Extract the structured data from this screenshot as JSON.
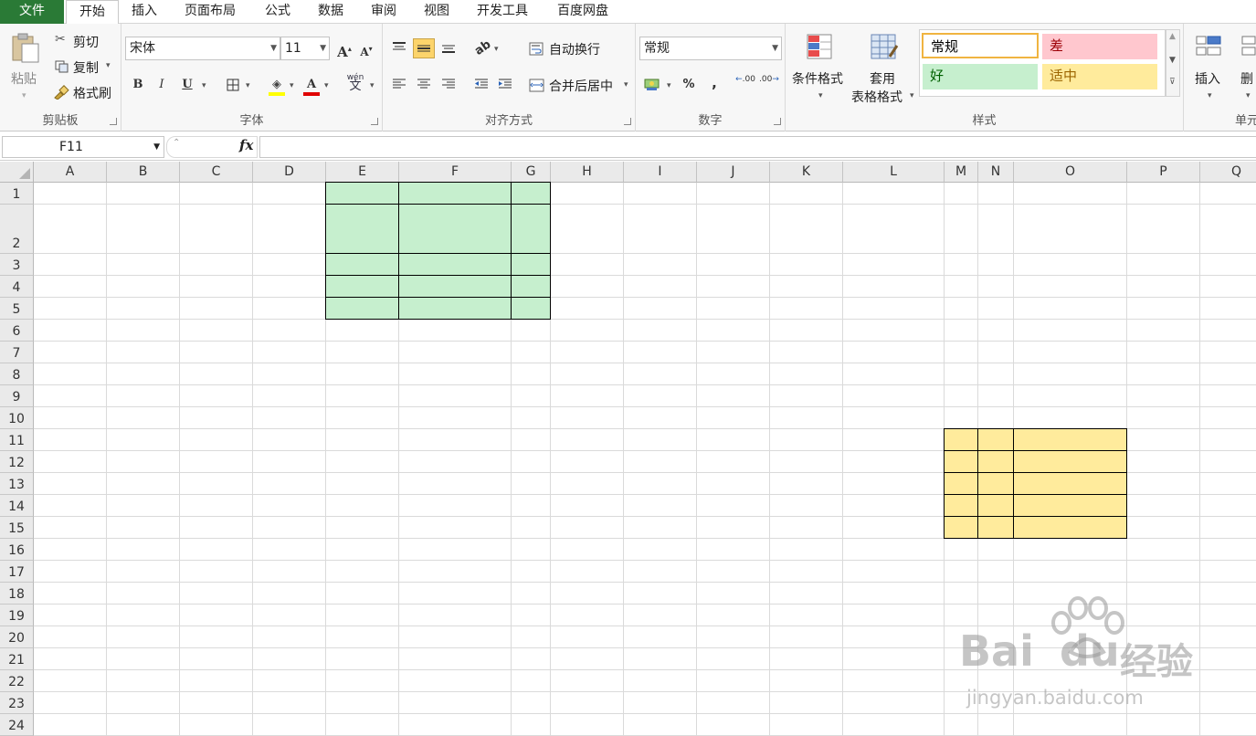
{
  "tabs": {
    "file": "文件",
    "home": "开始",
    "insert": "插入",
    "page_layout": "页面布局",
    "formulas": "公式",
    "data": "数据",
    "review": "审阅",
    "view": "视图",
    "developer": "开发工具",
    "baidu_netdisk": "百度网盘"
  },
  "clipboard": {
    "paste": "粘贴",
    "cut": "剪切",
    "copy": "复制",
    "format_painter": "格式刷",
    "group_label": "剪贴板"
  },
  "font": {
    "name": "宋体",
    "size": "11",
    "grow": "A",
    "shrink": "A",
    "bold": "B",
    "italic": "I",
    "underline": "U",
    "font_color_letter": "A",
    "phonetic": "wén",
    "group_label": "字体"
  },
  "alignment": {
    "wrap_text": "自动换行",
    "merge_center": "合并后居中",
    "group_label": "对齐方式"
  },
  "number": {
    "format": "常规",
    "percent": "%",
    "comma": ",",
    "increase_decimal": ".00",
    "decrease_decimal": ".00",
    "group_label": "数字"
  },
  "styles": {
    "conditional_format": "条件格式",
    "table_format_line1": "套用",
    "table_format_line2": "表格格式",
    "normal": "常规",
    "bad": "差",
    "good": "好",
    "neutral": "适中",
    "group_label": "样式"
  },
  "cells": {
    "insert": "插入",
    "delete": "删",
    "group_label": "单元"
  },
  "formula_bar": {
    "name_box": "F11",
    "fx": "fx",
    "content": ""
  },
  "sheet": {
    "columns": [
      "A",
      "B",
      "C",
      "D",
      "E",
      "F",
      "G",
      "H",
      "I",
      "J",
      "K",
      "L",
      "M",
      "N",
      "O",
      "P",
      "Q"
    ],
    "rows": [
      "1",
      "2",
      "3",
      "4",
      "5",
      "6",
      "7",
      "8",
      "9",
      "10",
      "11",
      "12",
      "13",
      "14",
      "15",
      "16",
      "17",
      "18",
      "19",
      "20",
      "21",
      "22",
      "23",
      "24"
    ],
    "green_block": {
      "range": "E1:G5",
      "color": "#c6efce"
    },
    "yellow_block": {
      "range": "M11:O15",
      "color": "#ffeb9c"
    }
  },
  "colors": {
    "file_tab": "#2a7a36",
    "good_fill": "#c6efce",
    "good_text": "#006100",
    "bad_fill": "#ffc7ce",
    "bad_text": "#9c0006",
    "neutral_fill": "#ffeb9c",
    "neutral_text": "#9c6500",
    "active_button": "#fcd46b"
  },
  "watermark": {
    "brand": "Bai",
    "brand2": "du",
    "suffix": "经验",
    "url": "jingyan.baidu.com"
  }
}
